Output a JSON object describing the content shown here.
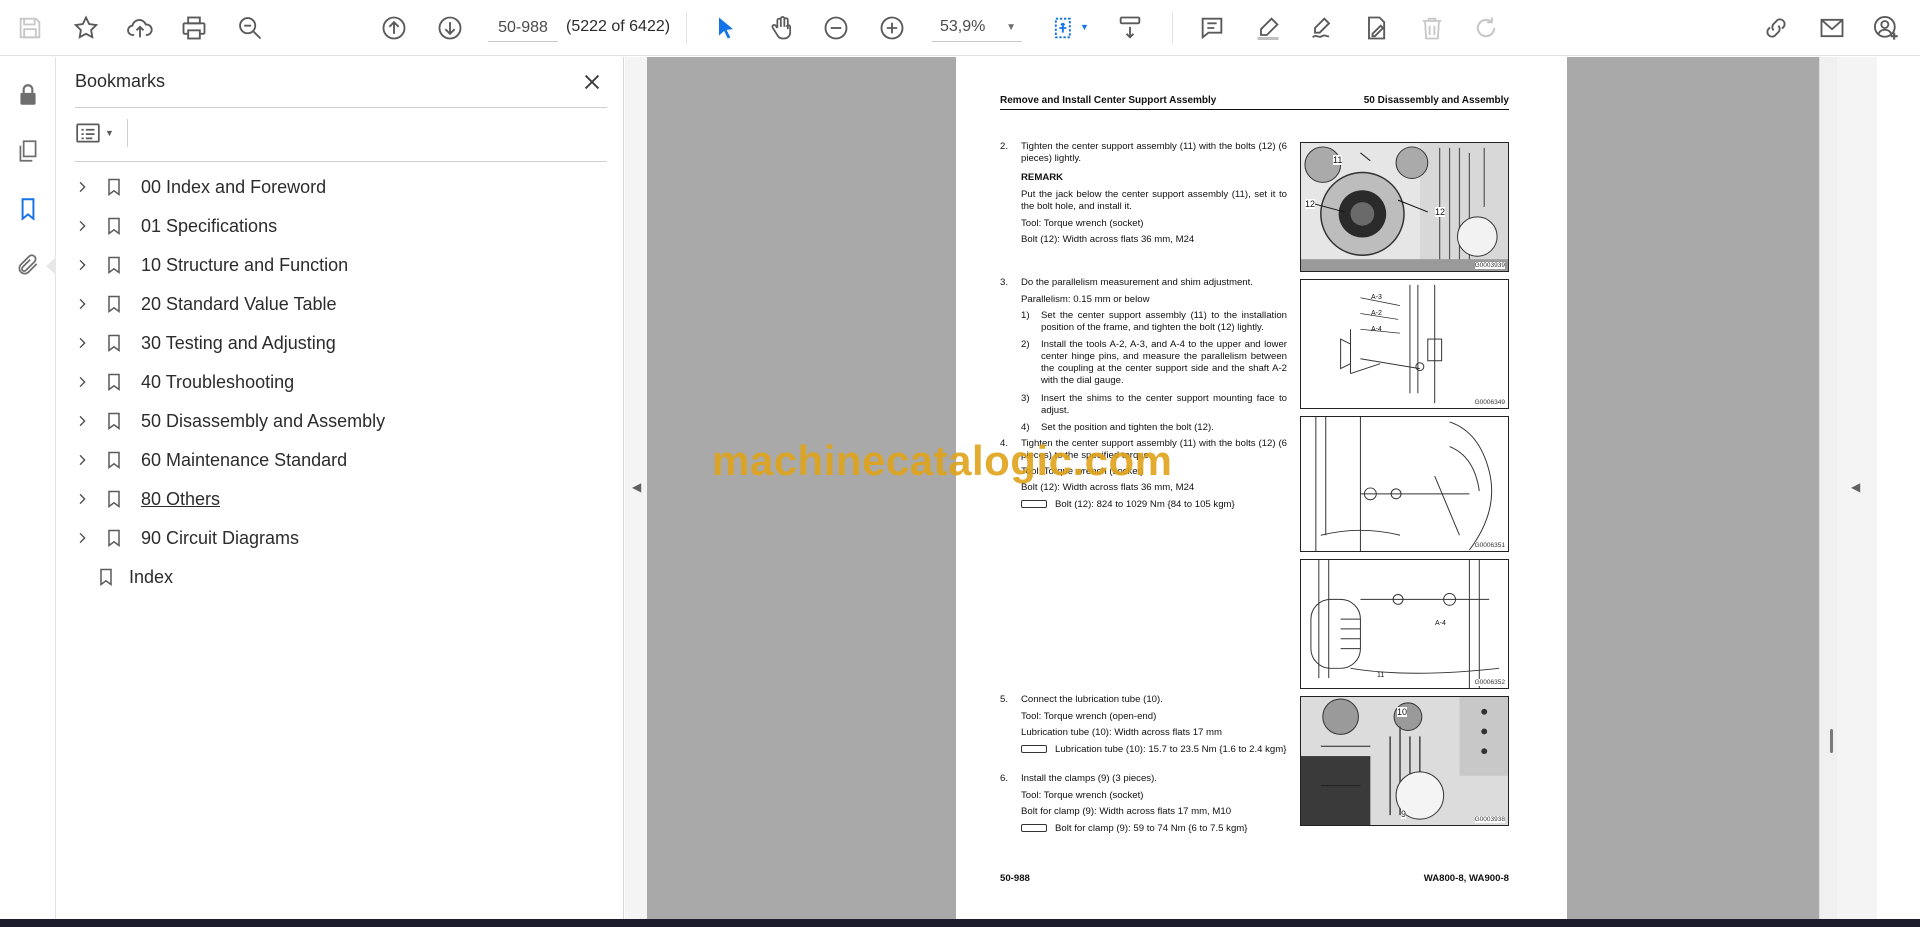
{
  "toolbar": {
    "page_value": "50-988",
    "page_count": "(5222 of 6422)",
    "zoom_value": "53,9%"
  },
  "bookmarks": {
    "title": "Bookmarks",
    "items": [
      {
        "label": "00 Index and Foreword",
        "expandable": true
      },
      {
        "label": "01 Specifications",
        "expandable": true
      },
      {
        "label": "10 Structure and Function",
        "expandable": true
      },
      {
        "label": "20 Standard Value Table",
        "expandable": true
      },
      {
        "label": "30 Testing and Adjusting",
        "expandable": true
      },
      {
        "label": "40 Troubleshooting",
        "expandable": true
      },
      {
        "label": "50 Disassembly and Assembly",
        "expandable": true
      },
      {
        "label": "60 Maintenance Standard",
        "expandable": true
      },
      {
        "label": "80 Others",
        "expandable": true
      },
      {
        "label": "90 Circuit Diagrams",
        "expandable": true
      },
      {
        "label": "Index",
        "expandable": false
      }
    ]
  },
  "page": {
    "header_left": "Remove and Install Center Support Assembly",
    "header_right": "50 Disassembly and Assembly",
    "step2": {
      "num": "2.",
      "text": "Tighten the center support assembly (11) with the bolts (12) (6 pieces) lightly.",
      "remark_title": "REMARK",
      "remark_text": "Put the jack below the center support assembly (11), set it to the bolt hole, and install it.",
      "tool": "Tool: Torque wrench (socket)",
      "bolt": "Bolt (12): Width across flats 36 mm, M24"
    },
    "step3": {
      "num": "3.",
      "text": "Do the parallelism measurement and shim adjustment.",
      "parallelism": "Parallelism: 0.15 mm or below",
      "sub": [
        {
          "num": "1)",
          "text": "Set the center support assembly (11) to the installation position of the frame, and tighten the bolt (12) lightly."
        },
        {
          "num": "2)",
          "text": "Install the tools A-2, A-3, and A-4 to the upper and lower center hinge pins, and measure the parallelism between the coupling at the center support side and the shaft A-2 with the dial gauge."
        },
        {
          "num": "3)",
          "text": "Insert the shims to the center support mounting face to adjust."
        },
        {
          "num": "4)",
          "text": "Set the position and tighten the bolt (12)."
        }
      ]
    },
    "step4": {
      "num": "4.",
      "text": "Tighten the center support assembly (11) with the bolts (12) (6 pieces) to the specified torque.",
      "tool": "Tool: Torque wrench (socket)",
      "bolt": "Bolt (12): Width across flats 36 mm, M24",
      "torque": "Bolt (12): 824 to 1029 Nm {84 to 105 kgm}"
    },
    "step5": {
      "num": "5.",
      "text": "Connect the lubrication tube (10).",
      "tool": "Tool: Torque wrench (open-end)",
      "tube": "Lubrication tube (10): Width across flats 17 mm",
      "torque": "Lubrication tube (10): 15.7 to 23.5 Nm {1.6 to 2.4 kgm}"
    },
    "step6": {
      "num": "6.",
      "text": "Install the clamps (9) (3 pieces).",
      "tool": "Tool: Torque wrench (socket)",
      "bolt": "Bolt for clamp (9): Width across flats 17 mm, M10",
      "torque": "Bolt for clamp (9): 59 to 74 Nm {6 to 7.5 kgm}"
    },
    "figures": [
      {
        "code": "G0003939",
        "labels": [
          "11",
          "12",
          "12"
        ]
      },
      {
        "code": "G0006349",
        "labels": [
          "A-3",
          "A-2",
          "A-4"
        ]
      },
      {
        "code": "G0006351",
        "labels": []
      },
      {
        "code": "G0006352",
        "labels": [
          "A-4",
          "11"
        ]
      },
      {
        "code": "G0003938",
        "labels": [
          "10",
          "9"
        ]
      }
    ],
    "footer_left": "50-988",
    "footer_right": "WA800-8, WA900-8"
  },
  "watermark": "machinecatalogic.com"
}
